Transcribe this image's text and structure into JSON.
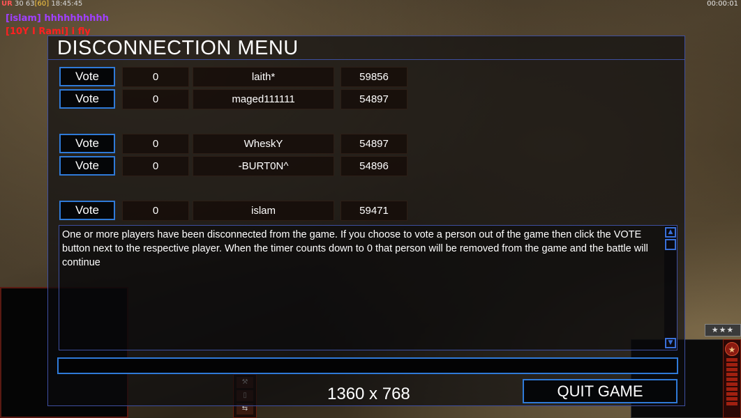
{
  "hud": {
    "ur": "UR",
    "stats": "30 63",
    "fps": "[60]",
    "clock": "18:45:45",
    "game_timer": "00:00:01"
  },
  "chat": [
    {
      "text": "[islam] hhhhhhhhhh",
      "color": "#a040ff"
    },
    {
      "text": "[10Y I Rami] i fly",
      "color": "#ff2020"
    }
  ],
  "side_panel": {
    "rank_stars": "★★★",
    "rank_badge": "★",
    "cmd_icons": [
      "⚒",
      "▯",
      "⇆"
    ]
  },
  "dialog": {
    "title": "DISCONNECTION MENU",
    "vote_label": "Vote",
    "players": [
      {
        "timer": "0",
        "name": "laith*",
        "ping": "59856"
      },
      {
        "timer": "0",
        "name": "maged111111",
        "ping": "54897"
      },
      {
        "timer": "0",
        "name": "WheskY",
        "ping": "54897"
      },
      {
        "timer": "0",
        "name": "-BURT0N^",
        "ping": "54896"
      },
      {
        "timer": "0",
        "name": "islam",
        "ping": "59471"
      }
    ],
    "message": "One or more players have been disconnected from the game. If you choose to vote a person out of the game then click the VOTE button next to the respective player. When the timer counts down to 0 that person will be removed from the game and the battle will continue",
    "chat_input_value": "",
    "resolution_label": "1360 x 768",
    "quit_label": "QUIT GAME",
    "scroll_up_icon": "▲",
    "scroll_down_icon": "▼"
  },
  "colors": {
    "accent": "#2f7ad8",
    "border": "#3e4fa0",
    "text": "#ffffff"
  }
}
